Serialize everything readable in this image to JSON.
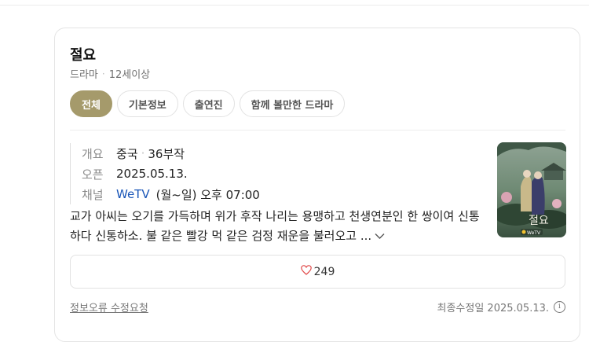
{
  "header": {
    "title": "절요",
    "category": "드라마",
    "rating": "12세이상"
  },
  "tabs": [
    {
      "label": "전체",
      "active": true
    },
    {
      "label": "기본정보",
      "active": false
    },
    {
      "label": "출연진",
      "active": false
    },
    {
      "label": "함께 볼만한 드라마",
      "active": false
    }
  ],
  "info": {
    "overview_key": "개요",
    "country": "중국",
    "episodes": "36부작",
    "open_key": "오픈",
    "open_date": "2025.05.13.",
    "channel_key": "채널",
    "channel_name": "WeTV",
    "schedule": "(월~일) 오후 07:00"
  },
  "synopsis": {
    "text": "교가 아씨는 오기를 가득하며 위가 후작 나리는 용맹하고 천생연분인 한 쌍이여 신통하다 신통하소. 불 같은 빨강 먹 같은 검정 재운을 불러오고 ...",
    "expand_icon": "chevron-down-icon"
  },
  "poster": {
    "title_overlay": "절요",
    "badge": "WeTV"
  },
  "like": {
    "count": "249",
    "icon": "heart-icon"
  },
  "footer": {
    "report_label": "정보오류 수정요청",
    "updated_text": "최종수정일 2025.05.13.",
    "info_icon": "info-icon"
  },
  "colors": {
    "accent": "#a59a6b",
    "link": "#1a56b8",
    "heart": "#e04646"
  }
}
